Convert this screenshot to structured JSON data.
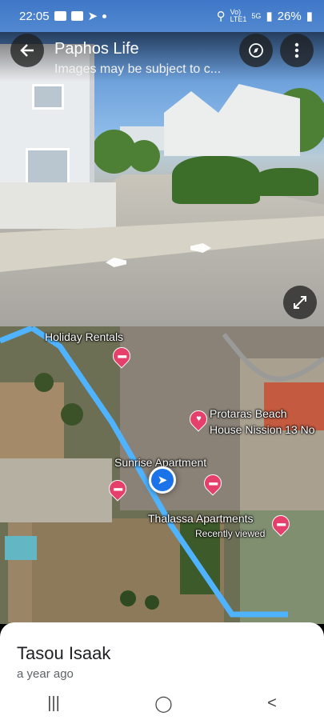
{
  "status_bar": {
    "time": "22:05",
    "network_top": "Vo)",
    "network_bottom": "LTE1",
    "signal_label": "5G",
    "battery": "26%"
  },
  "street_view": {
    "title": "Paphos Life",
    "subtitle": "Images may be subject to c...",
    "icons": [
      "back-arrow-icon",
      "compass-icon",
      "more-vert-icon",
      "expand-icon"
    ]
  },
  "map": {
    "labels": {
      "holiday_rentals": "Holiday Rentals",
      "protaras_line1": "Protaras Beach",
      "protaras_line2": "House Nission 13 No",
      "sunrise": "Sunrise Apartment",
      "thalassa": "Thalassa Apartments",
      "recently_viewed": "Recently viewed"
    },
    "colors": {
      "route": "#4fb3ff",
      "pin": "#e5406b",
      "location": "#1a73e8"
    }
  },
  "sheet": {
    "name": "Tasou Isaak",
    "time_ago": "a year ago"
  },
  "nav_bar": {
    "recents": "|||",
    "home": "◯",
    "back": "<"
  }
}
